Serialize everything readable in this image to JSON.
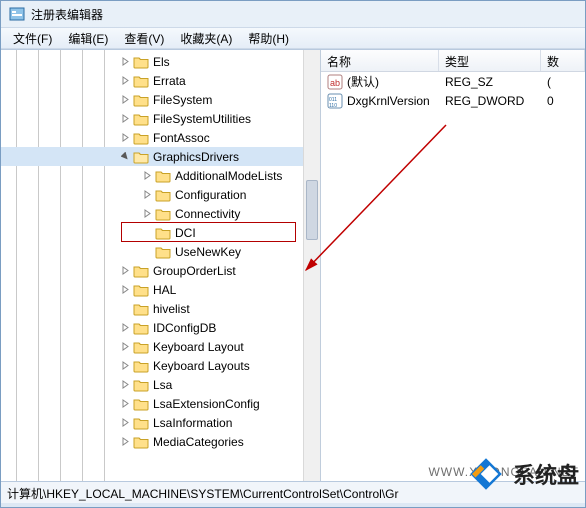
{
  "window": {
    "title": "注册表编辑器"
  },
  "menu": {
    "file": "文件(F)",
    "edit": "编辑(E)",
    "view": "查看(V)",
    "favorites": "收藏夹(A)",
    "help": "帮助(H)"
  },
  "tree": {
    "items": [
      {
        "label": "Els",
        "depth": 5,
        "exp": "closed"
      },
      {
        "label": "Errata",
        "depth": 5,
        "exp": "closed"
      },
      {
        "label": "FileSystem",
        "depth": 5,
        "exp": "closed"
      },
      {
        "label": "FileSystemUtilities",
        "depth": 5,
        "exp": "closed"
      },
      {
        "label": "FontAssoc",
        "depth": 5,
        "exp": "closed"
      },
      {
        "label": "GraphicsDrivers",
        "depth": 5,
        "exp": "open",
        "selected": true
      },
      {
        "label": "AdditionalModeLists",
        "depth": 6,
        "exp": "closed"
      },
      {
        "label": "Configuration",
        "depth": 6,
        "exp": "closed"
      },
      {
        "label": "Connectivity",
        "depth": 6,
        "exp": "closed"
      },
      {
        "label": "DCI",
        "depth": 6,
        "exp": "none",
        "highlight": true
      },
      {
        "label": "UseNewKey",
        "depth": 6,
        "exp": "none"
      },
      {
        "label": "GroupOrderList",
        "depth": 5,
        "exp": "closed"
      },
      {
        "label": "HAL",
        "depth": 5,
        "exp": "closed"
      },
      {
        "label": "hivelist",
        "depth": 5,
        "exp": "none"
      },
      {
        "label": "IDConfigDB",
        "depth": 5,
        "exp": "closed"
      },
      {
        "label": "Keyboard Layout",
        "depth": 5,
        "exp": "closed"
      },
      {
        "label": "Keyboard Layouts",
        "depth": 5,
        "exp": "closed"
      },
      {
        "label": "Lsa",
        "depth": 5,
        "exp": "closed"
      },
      {
        "label": "LsaExtensionConfig",
        "depth": 5,
        "exp": "closed"
      },
      {
        "label": "LsaInformation",
        "depth": 5,
        "exp": "closed"
      },
      {
        "label": "MediaCategories",
        "depth": 5,
        "exp": "closed"
      }
    ]
  },
  "list": {
    "columns": {
      "name": "名称",
      "type": "类型",
      "data": "数"
    },
    "rows": [
      {
        "name": "(默认)",
        "type": "REG_SZ",
        "data": "(",
        "icon": "string"
      },
      {
        "name": "DxgKrnlVersion",
        "type": "REG_DWORD",
        "data": "0",
        "icon": "binary"
      }
    ]
  },
  "statusbar": {
    "path": "计算机\\HKEY_LOCAL_MACHINE\\SYSTEM\\CurrentControlSet\\Control\\Gr"
  },
  "watermark": {
    "text": "WWW.XITONGPAN.NET"
  },
  "brand": {
    "text": "系统盘"
  }
}
